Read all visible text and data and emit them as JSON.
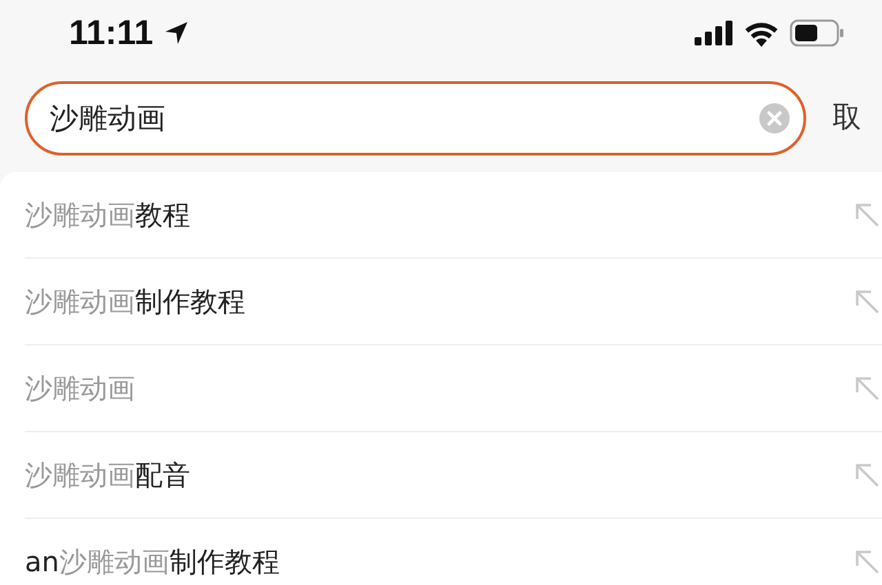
{
  "status_bar": {
    "time": "11:11"
  },
  "search": {
    "value": "沙雕动画",
    "cancel": "取"
  },
  "suggestions": [
    {
      "parts": [
        {
          "text": "沙雕动画",
          "matched": true
        },
        {
          "text": "教程",
          "matched": false
        }
      ]
    },
    {
      "parts": [
        {
          "text": "沙雕动画",
          "matched": true
        },
        {
          "text": "制作教程",
          "matched": false
        }
      ]
    },
    {
      "parts": [
        {
          "text": "沙雕动画",
          "matched": true
        }
      ]
    },
    {
      "parts": [
        {
          "text": "沙雕动画",
          "matched": true
        },
        {
          "text": "配音",
          "matched": false
        }
      ]
    },
    {
      "parts": [
        {
          "text": "an",
          "matched": false
        },
        {
          "text": "沙雕动画",
          "matched": true
        },
        {
          "text": "制作教程",
          "matched": false
        }
      ]
    }
  ]
}
